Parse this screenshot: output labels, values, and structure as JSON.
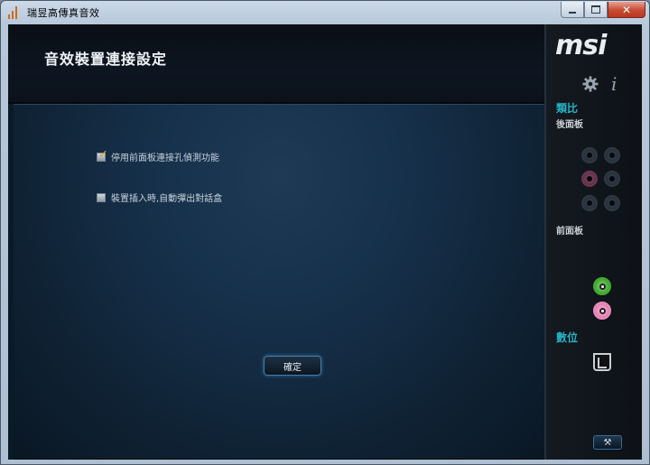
{
  "window": {
    "title": "瑞昱高傳真音效",
    "controls": {
      "minimize": "",
      "maximize": "",
      "close": "✕"
    }
  },
  "header": {
    "title": "音效裝置連接設定"
  },
  "options": [
    {
      "label": "停用前面板連接孔偵測功能",
      "checked": true
    },
    {
      "label": "裝置插入時,自動彈出對話盒",
      "checked": false
    }
  ],
  "ok_button": {
    "label": "確定"
  },
  "side": {
    "logo": "msi",
    "info_glyph": "i",
    "analog_title": "類比",
    "back_panel_label": "後面板",
    "front_panel_label": "前面板",
    "digital_title": "數位",
    "wrench_glyph": "⚒"
  },
  "colors": {
    "accent": "#27b3c6",
    "jack_green": "#3fae2e",
    "jack_pink": "#e98abb"
  }
}
